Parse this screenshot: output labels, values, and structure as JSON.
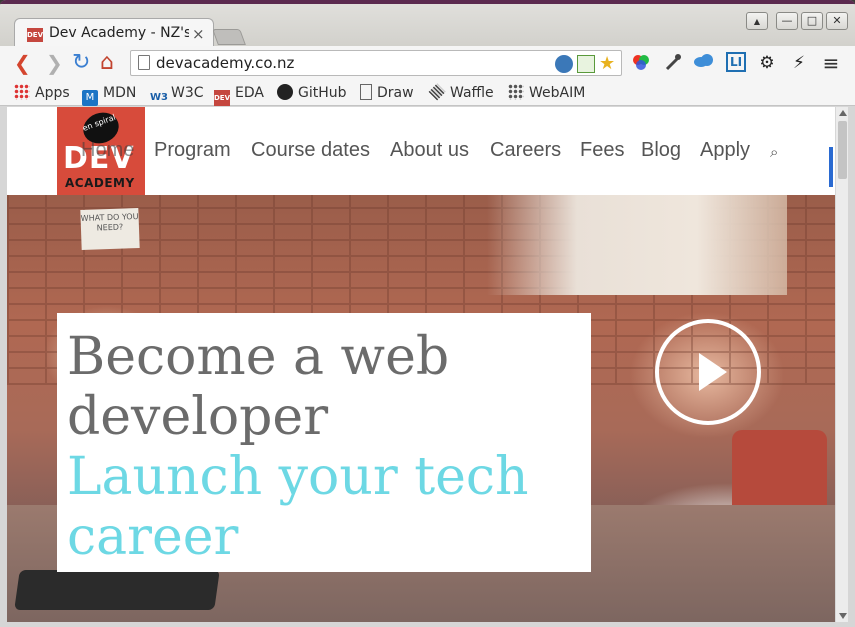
{
  "browser": {
    "tab": {
      "favicon_text": "DEV",
      "title": "Dev Academy - NZ's",
      "close_glyph": "×"
    },
    "window_controls": {
      "user_glyph": "▲",
      "minimize_glyph": "—",
      "maximize_glyph": "□",
      "close_glyph": "✕"
    },
    "nav": {
      "back_glyph": "❮",
      "forward_glyph": "❯",
      "reload_glyph": "↻",
      "home_glyph": "⌂"
    },
    "address": {
      "url": "devacademy.co.nz"
    },
    "menu_glyph": "≡",
    "bookmarks": [
      {
        "label": "Apps",
        "icon": "apps-icon"
      },
      {
        "label": "MDN",
        "icon": "mdn-icon"
      },
      {
        "label": "W3C",
        "icon": "w3c-icon"
      },
      {
        "label": "EDA",
        "icon": "eda-icon"
      },
      {
        "label": "GitHub",
        "icon": "github-icon"
      },
      {
        "label": "Draw",
        "icon": "draw-icon"
      },
      {
        "label": "Waffle",
        "icon": "waffle-icon"
      },
      {
        "label": "WebAIM",
        "icon": "webaim-icon"
      }
    ]
  },
  "site": {
    "logo": {
      "badge": "en spiral",
      "dev": "DEV",
      "academy": "ACADEMY"
    },
    "nav": [
      "Home",
      "Program",
      "Course dates",
      "About us",
      "Careers",
      "Fees",
      "Blog",
      "Apply"
    ],
    "search_glyph": "⌕",
    "hero": {
      "note": "WHAT DO YOU NEED?",
      "headline_line1": "Become a web",
      "headline_line2": "developer",
      "tagline_line1": "Launch your tech",
      "tagline_line2": "career"
    }
  },
  "colors": {
    "accent_cyan": "#6dd8e4",
    "brand_red": "#d74b3b",
    "scroll_marker": "#2a6ad1"
  }
}
